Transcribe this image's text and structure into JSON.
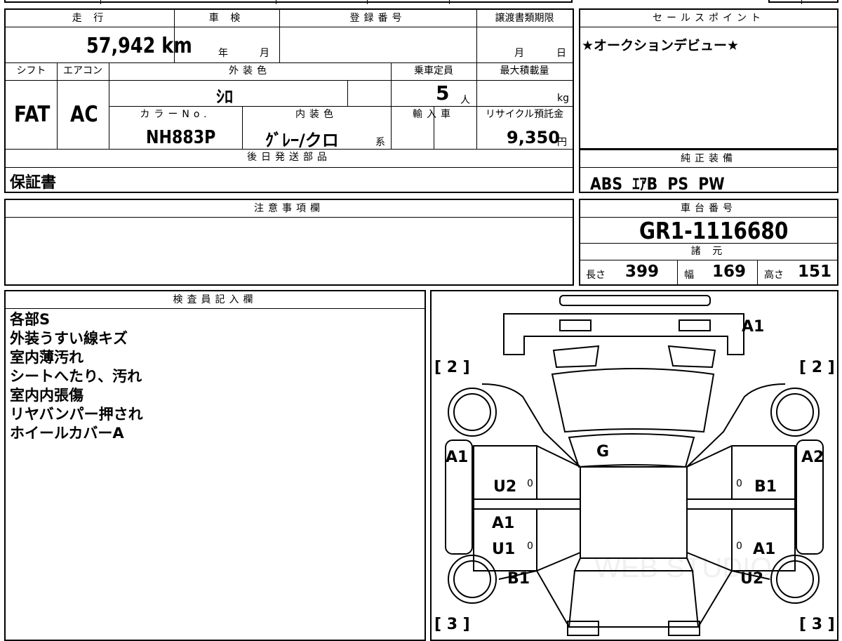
{
  "headers": {
    "mileage": "走 行",
    "inspection": "車 検",
    "registration": "登録番号",
    "transfer_deadline": "譲渡書類期限",
    "sales_point": "セールスポイント",
    "shift": "シフト",
    "aircon": "エアコン",
    "exterior_color": "外装色",
    "capacity": "乗車定員",
    "max_load": "最大積載量",
    "color_no": "カラーNo.",
    "interior_color": "内装色",
    "imported": "輸入車",
    "recycle": "リサイクル預託金",
    "later_parts": "後日発送部品",
    "genuine_equipment": "純正装備",
    "notes": "注意事項欄",
    "chassis_no": "車台番号",
    "specs": "諸 元",
    "inspector": "検査員記入欄"
  },
  "values": {
    "mileage": "57,942",
    "mileage_unit": "km",
    "inspection_year": "年",
    "inspection_month": "月",
    "transfer_month": "月",
    "transfer_day": "日",
    "sales_point": "★オークションデビュー★",
    "shift": "FAT",
    "aircon": "AC",
    "exterior_color": "ｼﾛ",
    "capacity": "5",
    "capacity_unit": "人",
    "max_load_unit": "kg",
    "color_no": "NH883P",
    "interior_color": "ｸﾞﾚｰ/クロ",
    "interior_suffix": "系",
    "recycle": "9,350",
    "recycle_unit": "円",
    "later_parts": "保証書",
    "genuine_equipment": "ABS  ｴｱB  PS  PW",
    "chassis_no": "GR1-1116680"
  },
  "specs": {
    "length_label": "長さ",
    "length": "399",
    "width_label": "幅",
    "width": "169",
    "height_label": "高さ",
    "height": "151"
  },
  "inspector_notes": [
    "各部S",
    "外装うすい線キズ",
    "室内薄汚れ",
    "シートへたり、汚れ",
    "室内内張傷",
    "リヤバンパー押され",
    "ホイールカバーA"
  ],
  "diagram": {
    "labels": {
      "front_right": "A1",
      "bracket_left_top": "[ 2 ]",
      "bracket_right_top": "[ 2 ]",
      "left_front_fender": "A1",
      "right_front_fender": "A2",
      "roof": "G",
      "left_front_door": "U2",
      "right_front_door": "B1",
      "left_rear_door_a": "A1",
      "left_rear_door_u": "U1",
      "right_rear_door": "A1",
      "left_rear_fender": "B1",
      "right_rear_fender": "U2",
      "bracket_left_bottom": "[ 3 ]",
      "bracket_right_bottom": "[ 3 ]",
      "zero": "0"
    },
    "watermark": "WEB STUDIO"
  }
}
